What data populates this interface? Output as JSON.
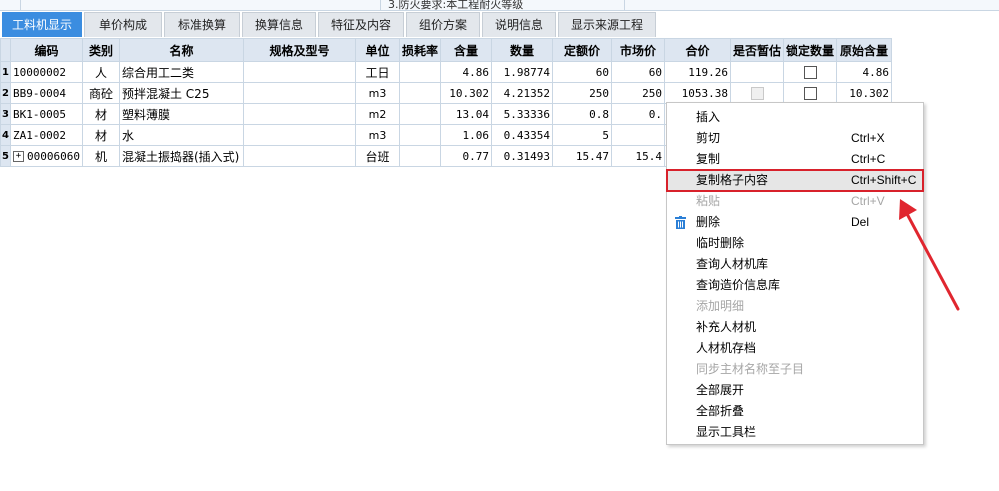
{
  "top_strip": {
    "note": "3.防火要求:本工程耐火等级"
  },
  "tabs": [
    {
      "label": "工料机显示",
      "active": true
    },
    {
      "label": "单价构成"
    },
    {
      "label": "标准换算"
    },
    {
      "label": "换算信息"
    },
    {
      "label": "特征及内容"
    },
    {
      "label": "组价方案"
    },
    {
      "label": "说明信息"
    },
    {
      "label": "显示来源工程"
    }
  ],
  "table": {
    "headers": [
      "编码",
      "类别",
      "名称",
      "规格及型号",
      "单位",
      "损耗率",
      "含量",
      "数量",
      "定额价",
      "市场价",
      "合价",
      "是否暂估",
      "锁定数量",
      "原始含量"
    ],
    "rows": [
      {
        "rn": "1",
        "code": "10000002",
        "type": "人",
        "name": "综合用工二类",
        "spec": "",
        "unit": "工日",
        "loss": "",
        "qty_per": "4.86",
        "qty": "1.98774",
        "fixed_price": "60",
        "market_price": "60",
        "total": "119.26",
        "original": "4.86"
      },
      {
        "rn": "2",
        "code": "BB9-0004",
        "type": "商砼",
        "name": "预拌混凝土 C25",
        "spec": "",
        "unit": "m3",
        "loss": "",
        "qty_per": "10.302",
        "qty": "4.21352",
        "fixed_price": "250",
        "market_price": "250",
        "total": "1053.38",
        "original": "10.302"
      },
      {
        "rn": "3",
        "code": "BK1-0005",
        "type": "材",
        "name": "塑料薄膜",
        "spec": "",
        "unit": "m2",
        "loss": "",
        "qty_per": "13.04",
        "qty": "5.33336",
        "fixed_price": "0.8",
        "market_price": "0.",
        "total": "",
        "original": ""
      },
      {
        "rn": "4",
        "code": "ZA1-0002",
        "type": "材",
        "name": "水",
        "spec": "",
        "unit": "m3",
        "loss": "",
        "qty_per": "1.06",
        "qty": "0.43354",
        "fixed_price": "5",
        "market_price": "",
        "total": "",
        "original": ""
      },
      {
        "rn": "5",
        "code": "00006060",
        "type": "机",
        "name": "混凝土振捣器(插入式)",
        "spec": "",
        "unit": "台班",
        "loss": "",
        "qty_per": "0.77",
        "qty": "0.31493",
        "fixed_price": "15.47",
        "market_price": "15.4",
        "total": "",
        "original": "",
        "expand": "+"
      }
    ]
  },
  "context_menu": {
    "items": [
      {
        "label": "插入",
        "shortcut": "",
        "disabled": false
      },
      {
        "label": "剪切",
        "shortcut": "Ctrl+X",
        "disabled": false
      },
      {
        "label": "复制",
        "shortcut": "Ctrl+C",
        "disabled": false
      },
      {
        "label": "复制格子内容",
        "shortcut": "Ctrl+Shift+C",
        "disabled": false,
        "highlighted": true
      },
      {
        "label": "粘贴",
        "shortcut": "Ctrl+V",
        "disabled": true
      },
      {
        "label": "删除",
        "shortcut": "Del",
        "disabled": false,
        "icon": "trash-icon"
      },
      {
        "label": "临时删除",
        "shortcut": "",
        "disabled": false
      },
      {
        "label": "查询人材机库",
        "shortcut": "",
        "disabled": false
      },
      {
        "label": "查询造价信息库",
        "shortcut": "",
        "disabled": false
      },
      {
        "label": "添加明细",
        "shortcut": "",
        "disabled": true
      },
      {
        "label": "补充人材机",
        "shortcut": "",
        "disabled": false
      },
      {
        "label": "人材机存档",
        "shortcut": "",
        "disabled": false
      },
      {
        "label": "同步主材名称至子目",
        "shortcut": "",
        "disabled": true
      },
      {
        "label": "全部展开",
        "shortcut": "",
        "disabled": false
      },
      {
        "label": "全部折叠",
        "shortcut": "",
        "disabled": false
      },
      {
        "label": "显示工具栏",
        "shortcut": "",
        "disabled": false
      }
    ]
  },
  "colors": {
    "accent": "#3b8de0",
    "highlight_border": "#d8212b",
    "arrow": "#e0262f",
    "header_bg": "#dde6f1"
  }
}
